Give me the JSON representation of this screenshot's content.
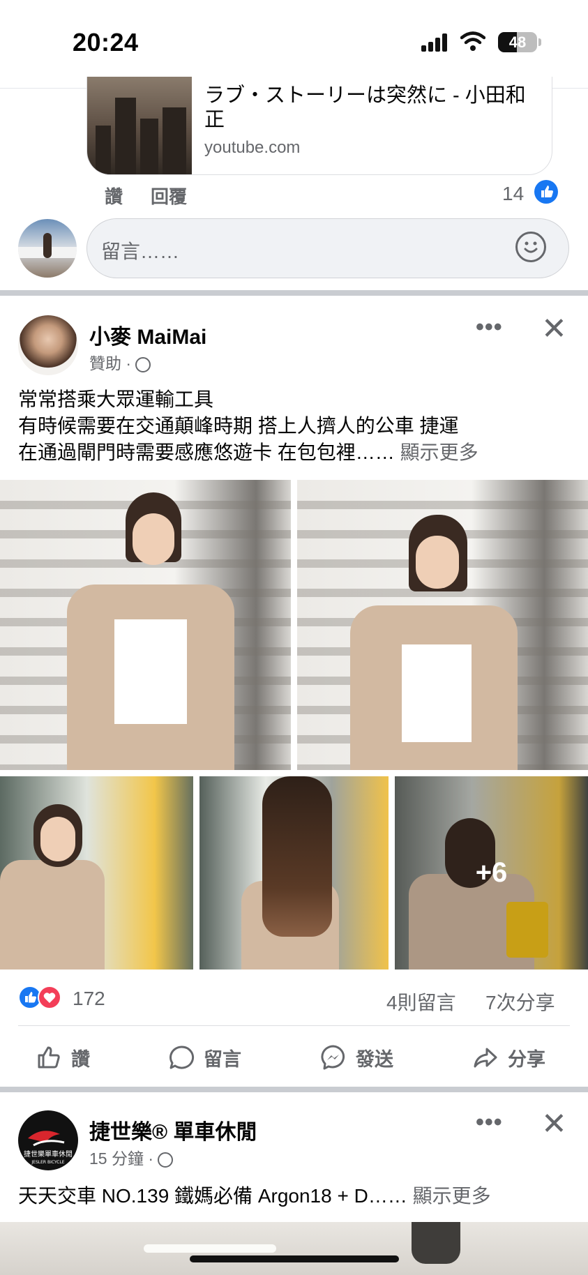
{
  "status_bar": {
    "time": "20:24",
    "battery": "48",
    "battery_level": 0.48,
    "icons": [
      "signal-icon",
      "wifi-icon",
      "battery-icon"
    ]
  },
  "prev_post": {
    "link_card": {
      "title": "ラブ・ストーリーは突然に - 小田和正",
      "domain": "youtube.com"
    },
    "actions": {
      "like": "讚",
      "reply": "回覆"
    },
    "like_count": "14",
    "comment_placeholder": "留言……"
  },
  "post1": {
    "author": "小麥 MaiMai",
    "meta": "贊助 ·",
    "text_lines": [
      "常常搭乘大眾運輸工具",
      "有時候需要在交通顛峰時期 搭上人擠人的公車 捷運",
      "在通過閘門時需要感應悠遊卡 在包包裡……"
    ],
    "see_more": "顯示更多",
    "photos_more": "+6",
    "reaction_count": "172",
    "comments_count": "4則留言",
    "shares_count": "7次分享",
    "actions": {
      "like": "讚",
      "comment": "留言",
      "send": "發送",
      "share": "分享"
    }
  },
  "post2": {
    "author": "捷世樂® 單車休閒",
    "meta": "15 分鐘 ·",
    "text": "天天交車 NO.139 鐵媽必備 Argon18 + D……",
    "see_more": "顯示更多",
    "logo_text": "捷世樂單車休閒",
    "logo_sub": "JESLER BICYCLE"
  },
  "colors": {
    "brand_blue": "#1877f2",
    "love_red": "#f33e58",
    "secondary_text": "#65676b",
    "separator": "#c9ccd1"
  }
}
